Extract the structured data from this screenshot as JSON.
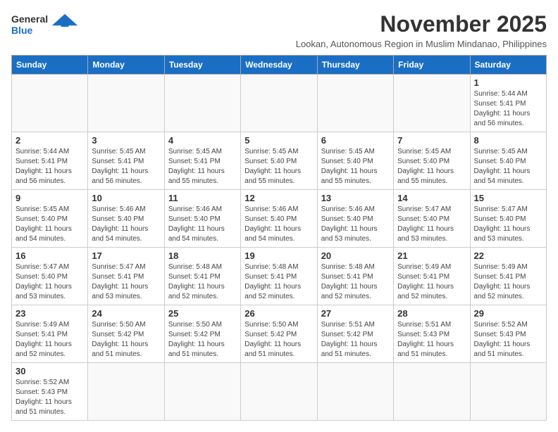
{
  "header": {
    "logo_line1": "General",
    "logo_line2": "Blue",
    "month_title": "November 2025",
    "location": "Lookan, Autonomous Region in Muslim Mindanao, Philippines"
  },
  "weekdays": [
    "Sunday",
    "Monday",
    "Tuesday",
    "Wednesday",
    "Thursday",
    "Friday",
    "Saturday"
  ],
  "weeks": [
    [
      {
        "day": "",
        "info": ""
      },
      {
        "day": "",
        "info": ""
      },
      {
        "day": "",
        "info": ""
      },
      {
        "day": "",
        "info": ""
      },
      {
        "day": "",
        "info": ""
      },
      {
        "day": "",
        "info": ""
      },
      {
        "day": "1",
        "info": "Sunrise: 5:44 AM\nSunset: 5:41 PM\nDaylight: 11 hours\nand 56 minutes."
      }
    ],
    [
      {
        "day": "2",
        "info": "Sunrise: 5:44 AM\nSunset: 5:41 PM\nDaylight: 11 hours\nand 56 minutes."
      },
      {
        "day": "3",
        "info": "Sunrise: 5:45 AM\nSunset: 5:41 PM\nDaylight: 11 hours\nand 56 minutes."
      },
      {
        "day": "4",
        "info": "Sunrise: 5:45 AM\nSunset: 5:41 PM\nDaylight: 11 hours\nand 55 minutes."
      },
      {
        "day": "5",
        "info": "Sunrise: 5:45 AM\nSunset: 5:40 PM\nDaylight: 11 hours\nand 55 minutes."
      },
      {
        "day": "6",
        "info": "Sunrise: 5:45 AM\nSunset: 5:40 PM\nDaylight: 11 hours\nand 55 minutes."
      },
      {
        "day": "7",
        "info": "Sunrise: 5:45 AM\nSunset: 5:40 PM\nDaylight: 11 hours\nand 55 minutes."
      },
      {
        "day": "8",
        "info": "Sunrise: 5:45 AM\nSunset: 5:40 PM\nDaylight: 11 hours\nand 54 minutes."
      }
    ],
    [
      {
        "day": "9",
        "info": "Sunrise: 5:45 AM\nSunset: 5:40 PM\nDaylight: 11 hours\nand 54 minutes."
      },
      {
        "day": "10",
        "info": "Sunrise: 5:46 AM\nSunset: 5:40 PM\nDaylight: 11 hours\nand 54 minutes."
      },
      {
        "day": "11",
        "info": "Sunrise: 5:46 AM\nSunset: 5:40 PM\nDaylight: 11 hours\nand 54 minutes."
      },
      {
        "day": "12",
        "info": "Sunrise: 5:46 AM\nSunset: 5:40 PM\nDaylight: 11 hours\nand 54 minutes."
      },
      {
        "day": "13",
        "info": "Sunrise: 5:46 AM\nSunset: 5:40 PM\nDaylight: 11 hours\nand 53 minutes."
      },
      {
        "day": "14",
        "info": "Sunrise: 5:47 AM\nSunset: 5:40 PM\nDaylight: 11 hours\nand 53 minutes."
      },
      {
        "day": "15",
        "info": "Sunrise: 5:47 AM\nSunset: 5:40 PM\nDaylight: 11 hours\nand 53 minutes."
      }
    ],
    [
      {
        "day": "16",
        "info": "Sunrise: 5:47 AM\nSunset: 5:40 PM\nDaylight: 11 hours\nand 53 minutes."
      },
      {
        "day": "17",
        "info": "Sunrise: 5:47 AM\nSunset: 5:41 PM\nDaylight: 11 hours\nand 53 minutes."
      },
      {
        "day": "18",
        "info": "Sunrise: 5:48 AM\nSunset: 5:41 PM\nDaylight: 11 hours\nand 52 minutes."
      },
      {
        "day": "19",
        "info": "Sunrise: 5:48 AM\nSunset: 5:41 PM\nDaylight: 11 hours\nand 52 minutes."
      },
      {
        "day": "20",
        "info": "Sunrise: 5:48 AM\nSunset: 5:41 PM\nDaylight: 11 hours\nand 52 minutes."
      },
      {
        "day": "21",
        "info": "Sunrise: 5:49 AM\nSunset: 5:41 PM\nDaylight: 11 hours\nand 52 minutes."
      },
      {
        "day": "22",
        "info": "Sunrise: 5:49 AM\nSunset: 5:41 PM\nDaylight: 11 hours\nand 52 minutes."
      }
    ],
    [
      {
        "day": "23",
        "info": "Sunrise: 5:49 AM\nSunset: 5:41 PM\nDaylight: 11 hours\nand 52 minutes."
      },
      {
        "day": "24",
        "info": "Sunrise: 5:50 AM\nSunset: 5:42 PM\nDaylight: 11 hours\nand 51 minutes."
      },
      {
        "day": "25",
        "info": "Sunrise: 5:50 AM\nSunset: 5:42 PM\nDaylight: 11 hours\nand 51 minutes."
      },
      {
        "day": "26",
        "info": "Sunrise: 5:50 AM\nSunset: 5:42 PM\nDaylight: 11 hours\nand 51 minutes."
      },
      {
        "day": "27",
        "info": "Sunrise: 5:51 AM\nSunset: 5:42 PM\nDaylight: 11 hours\nand 51 minutes."
      },
      {
        "day": "28",
        "info": "Sunrise: 5:51 AM\nSunset: 5:43 PM\nDaylight: 11 hours\nand 51 minutes."
      },
      {
        "day": "29",
        "info": "Sunrise: 5:52 AM\nSunset: 5:43 PM\nDaylight: 11 hours\nand 51 minutes."
      }
    ],
    [
      {
        "day": "30",
        "info": "Sunrise: 5:52 AM\nSunset: 5:43 PM\nDaylight: 11 hours\nand 51 minutes."
      },
      {
        "day": "",
        "info": ""
      },
      {
        "day": "",
        "info": ""
      },
      {
        "day": "",
        "info": ""
      },
      {
        "day": "",
        "info": ""
      },
      {
        "day": "",
        "info": ""
      },
      {
        "day": "",
        "info": ""
      }
    ]
  ]
}
